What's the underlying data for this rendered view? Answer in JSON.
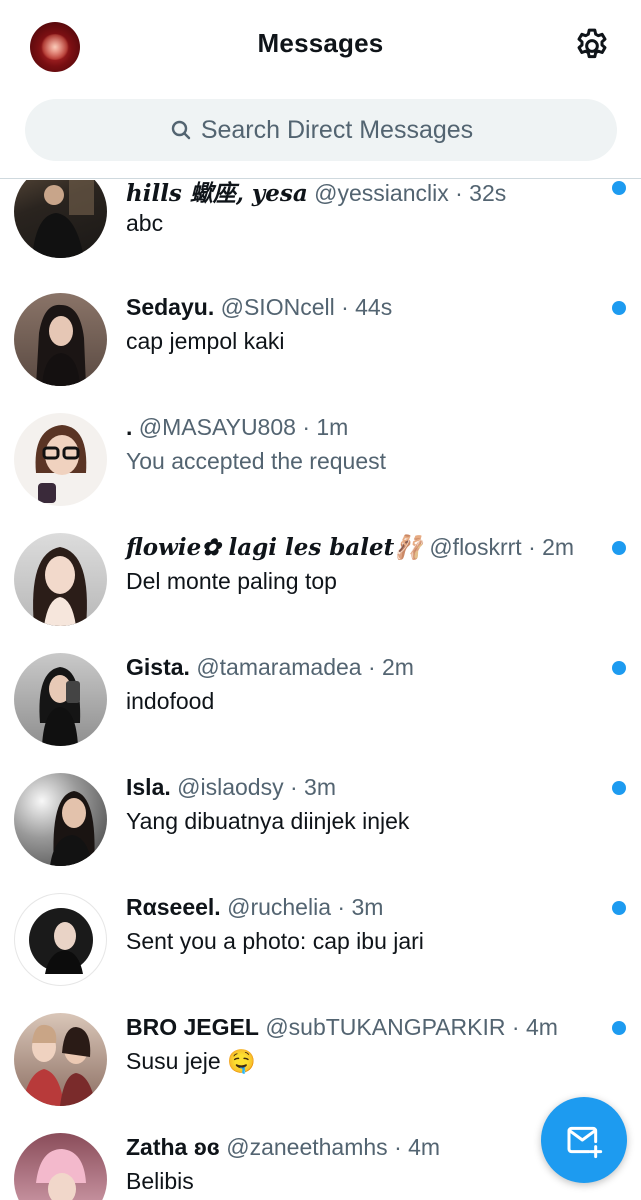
{
  "header": {
    "title": "Messages",
    "search_placeholder": "Search Direct Messages"
  },
  "colors": {
    "accent": "#1d9bf0",
    "muted_text": "#536471",
    "search_bg": "#eff3f4"
  },
  "conversations": [
    {
      "name": "hills 蠍座, yesa",
      "handle": "@yessianclix",
      "time": "· 32s",
      "preview": "abc",
      "unread": true
    },
    {
      "name": "Sedayu.",
      "handle": "@SIONcell",
      "time": "· 44s",
      "preview": "cap  jempol kaki",
      "unread": true
    },
    {
      "name": ".",
      "handle": "@MASAYU808",
      "time": "· 1m",
      "preview": "You accepted the request",
      "unread": false
    },
    {
      "name": "flowie✿ lagi les balet🩰",
      "handle": "@floskrrt",
      "time": "· 2m",
      "preview": "Del monte paling top",
      "unread": true
    },
    {
      "name": "Gista.",
      "handle": "@tamaramadea",
      "time": "· 2m",
      "preview": "indofood",
      "unread": true
    },
    {
      "name": "Isla.",
      "handle": "@islaodsy",
      "time": "· 3m",
      "preview": "Yang dibuatnya diinjek injek",
      "unread": true
    },
    {
      "name": "Rαseeel.",
      "handle": "@ruchelia",
      "time": "· 3m",
      "preview": "Sent you a photo: cap ibu jari",
      "unread": true
    },
    {
      "name": "BRO JEGEL",
      "handle": "@subTUKANGPARKIR",
      "time": "· 4m",
      "preview": "Susu jeje 🤤",
      "unread": true
    },
    {
      "name": "Zatha ʚɞ",
      "handle": "@zaneethamhs",
      "time": "· 4m",
      "preview": "Belibis",
      "unread": false
    }
  ],
  "icons": {
    "settings": "gear-icon",
    "search": "search-icon",
    "compose": "new-message-icon"
  }
}
